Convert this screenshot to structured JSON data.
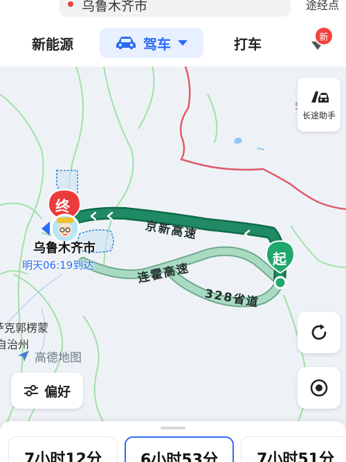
{
  "search": {
    "text": "乌鲁木齐市"
  },
  "top_right": {
    "text": "途经点"
  },
  "tabs": {
    "energy": "新能源",
    "drive": "驾车",
    "taxi": "打车",
    "badge": "新"
  },
  "map": {
    "highway_jingxin": "京新高速",
    "highway_lianhuo": "连霍高速",
    "highway_328": "328省道",
    "start_marker": "起",
    "end_marker": "终",
    "destination": "乌鲁木齐市",
    "eta": "明天06:19到达",
    "region_line1": "哈萨克郭楞蒙",
    "region_line2": "自治州",
    "logo": "高德地图",
    "corner_letter": "S"
  },
  "assist": {
    "label": "长途助手"
  },
  "preference": {
    "label": "偏好"
  },
  "routes": [
    {
      "duration": "7小时12分"
    },
    {
      "duration": "6小时53分"
    },
    {
      "duration": "7小时51分"
    }
  ],
  "colors": {
    "accent": "#2a6cf6",
    "route_main": "#1f8a63",
    "route_alt": "#8ec8ae",
    "start_green": "#1fa86b",
    "end_red": "#ec3b3b",
    "border_red": "#e05a6a"
  }
}
